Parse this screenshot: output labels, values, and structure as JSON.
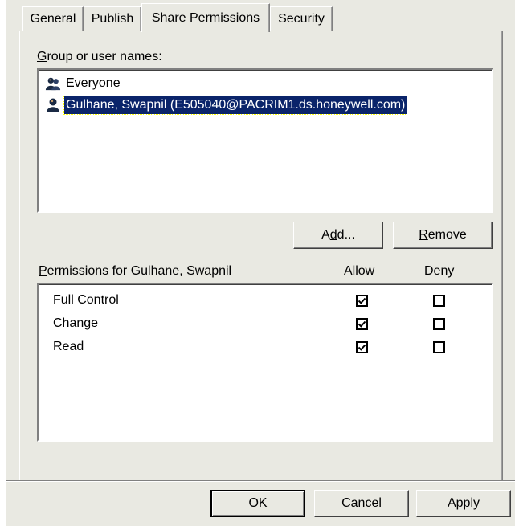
{
  "tabs": [
    {
      "label": "General"
    },
    {
      "label": "Publish"
    },
    {
      "label": "Share Permissions"
    },
    {
      "label": "Security"
    }
  ],
  "groups": {
    "label_prefix": "G",
    "label_rest": "roup or user names:",
    "items": [
      {
        "name": "Everyone",
        "icon": "group-icon"
      },
      {
        "name": "Gulhane, Swapnil (E505040@PACRIM1.ds.honeywell.com)",
        "icon": "user-icon",
        "selected": true
      }
    ]
  },
  "buttons": {
    "add_prefix": "A",
    "add_ul": "d",
    "add_rest": "d...",
    "remove_ul": "R",
    "remove_rest": "emove",
    "ok": "OK",
    "cancel": "Cancel",
    "apply_ul": "A",
    "apply_rest": "pply"
  },
  "permissions": {
    "label_ul": "P",
    "label_rest": "ermissions for Gulhane, Swapnil",
    "allow_header": "Allow",
    "deny_header": "Deny",
    "rows": [
      {
        "name": "Full Control",
        "allow": true,
        "deny": false
      },
      {
        "name": "Change",
        "allow": true,
        "deny": false
      },
      {
        "name": "Read",
        "allow": true,
        "deny": false
      }
    ]
  }
}
